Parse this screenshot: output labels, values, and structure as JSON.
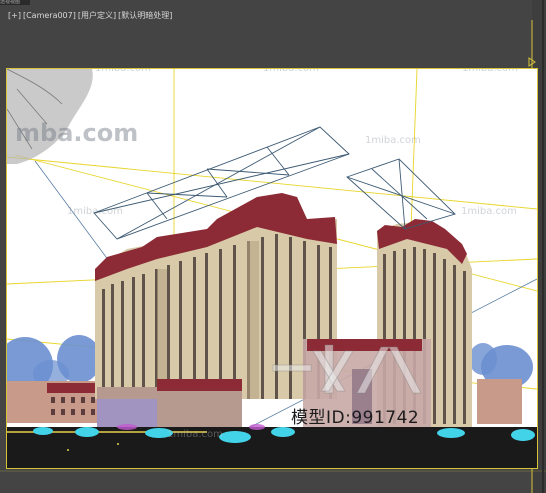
{
  "window": {
    "corner_label": "透视视图"
  },
  "viewport_label": {
    "plus": "[+]",
    "camera": "[Camera007]",
    "view_mode": "[用户定义]",
    "shading": "[默认明暗处理]"
  },
  "watermarks": {
    "big": "mba.com",
    "small": "1miba.com",
    "model_id": "模型ID:991742"
  },
  "colors": {
    "background": "#444444",
    "safe_frame": "#d7c33a",
    "camera_guide": "#e8d52a",
    "wire": "#3d5a73",
    "building_face": "#d8c9a8",
    "building_roof": "#8c2a35",
    "tree": "#6a8fd0",
    "shrub": "#43d3e8",
    "ground": "#1a1a1a"
  }
}
